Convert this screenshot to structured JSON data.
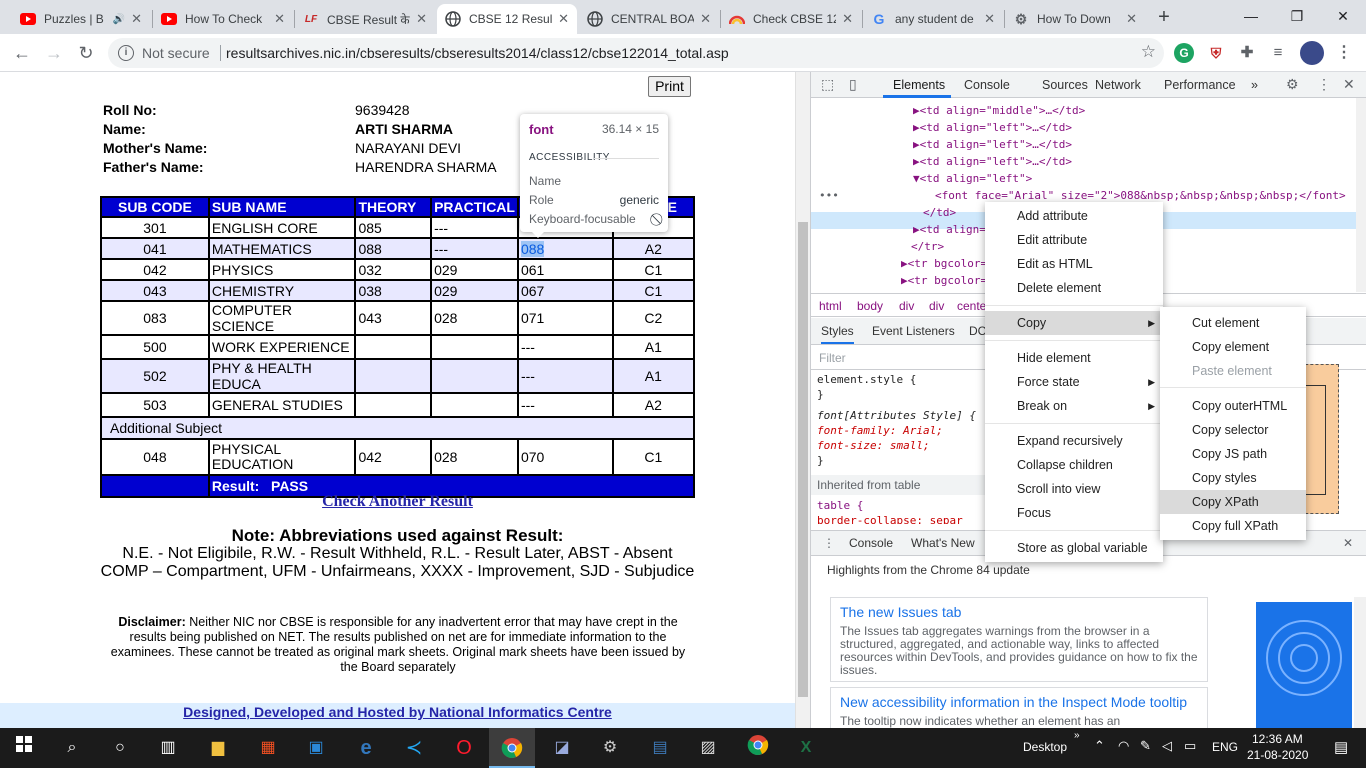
{
  "tabs": [
    {
      "title": "Puzzles | B",
      "icon": "youtube-icon"
    },
    {
      "title": "How To Check",
      "icon": "youtube-icon"
    },
    {
      "title": "CBSE Result के",
      "icon": "lf-icon"
    },
    {
      "title": "CBSE 12 Result",
      "icon": "globe-icon",
      "active": true
    },
    {
      "title": "CENTRAL BOA",
      "icon": "globe-icon"
    },
    {
      "title": "Check CBSE 12",
      "icon": "rainbow-icon"
    },
    {
      "title": "any student de",
      "icon": "google-icon"
    },
    {
      "title": "How To Down",
      "icon": "gear-icon"
    }
  ],
  "address": {
    "security": "Not secure",
    "url": "resultsarchives.nic.in/cbseresults/cbseresults2014/class12/cbse122014_total.asp"
  },
  "page": {
    "print_label": "Print",
    "info": [
      {
        "label": "Roll No:",
        "value": "9639428",
        "bold": false
      },
      {
        "label": "Name:",
        "value": "ARTI SHARMA",
        "bold": true
      },
      {
        "label": "Mother's Name:",
        "value": "NARAYANI DEVI",
        "bold": false
      },
      {
        "label": "Father's Name:",
        "value": "HARENDRA SHARMA",
        "bold": false
      }
    ],
    "table_headers": [
      "SUB CODE",
      "SUB NAME",
      "THEORY",
      "PRACTICAL",
      "",
      "E"
    ],
    "rows": [
      [
        "301",
        "ENGLISH CORE",
        "085",
        "---",
        "",
        ""
      ],
      [
        "041",
        "MATHEMATICS",
        "088",
        "---",
        "088",
        "A2"
      ],
      [
        "042",
        "PHYSICS",
        "032",
        "029",
        "061",
        "C1"
      ],
      [
        "043",
        "CHEMISTRY",
        "038",
        "029",
        "067",
        "C1"
      ],
      [
        "083",
        "COMPUTER SCIENCE",
        "043",
        "028",
        "071",
        "C2"
      ],
      [
        "500",
        "WORK EXPERIENCE",
        "",
        "",
        "---",
        "A1"
      ],
      [
        "502",
        "PHY & HEALTH EDUCA",
        "",
        "",
        "---",
        "A1"
      ],
      [
        "503",
        "GENERAL STUDIES",
        "",
        "",
        "---",
        "A2"
      ]
    ],
    "additional_label": "Additional Subject",
    "additional_row": [
      "048",
      "PHYSICAL EDUCATION",
      "042",
      "028",
      "070",
      "C1"
    ],
    "result_label": "Result:",
    "result_value": "PASS",
    "check_another": "Check Another Result",
    "note_title": "Note: Abbreviations used against Result:",
    "note_line1": "N.E. - Not Eligibile, R.W. - Result Withheld, R.L. - Result Later, ABST - Absent",
    "note_line2": "COMP – Compartment, UFM - Unfairmeans, XXXX - Improvement, SJD - Subjudice",
    "disclaimer_label": "Disclaimer:",
    "disclaimer_text": "Neither NIC nor CBSE is responsible for any inadvertent error that may have crept in the results being published on NET. The results published on net are for immediate information to the examinees. These cannot be treated as original mark sheets. Original mark sheets have been issued by the Board separately",
    "footer": "Designed, Developed and Hosted by National Informatics Centre"
  },
  "tooltip": {
    "tag": "font",
    "dims": "36.14 × 15",
    "section": "ACCESSIBILITY",
    "name_label": "Name",
    "name_value": "",
    "role_label": "Role",
    "role_value": "generic",
    "kbd_label": "Keyboard-focusable"
  },
  "devtools": {
    "tabs": [
      "Elements",
      "Console",
      "Sources",
      "Network",
      "Performance"
    ],
    "more": "»",
    "dom_lines": [
      {
        "text": "▶<td align=\"middle\">…</td>"
      },
      {
        "text": "▶<td align=\"left\">…</td>"
      },
      {
        "text": "▶<td align=\"left\">…</td>"
      },
      {
        "text": "▶<td align=\"left\">…</td>"
      },
      {
        "text": "▼<td align=\"left\">"
      },
      {
        "text": "<font face=\"Arial\" size=\"2\">088&nbsp;&nbsp;&nbsp;&nbsp;</font>"
      },
      {
        "text": "</td>"
      },
      {
        "text": "▶<td align="
      },
      {
        "text": "</tr>"
      },
      {
        "text": "▶<tr bgcolor="
      },
      {
        "text": "▶<tr bgcolor="
      }
    ],
    "breadcrumbs": [
      "html",
      "body",
      "div",
      "div",
      "cente"
    ],
    "subtabs": [
      "Styles",
      "Event Listeners",
      "DC"
    ],
    "filter_placeholder": "Filter",
    "style_lines": [
      "element.style {",
      "}",
      "font[Attributes Style] {",
      "  font-family: Arial;",
      "  font-size: small;",
      "}",
      "Inherited from table",
      "table {",
      "  border-collapse: separ"
    ],
    "drawer_tabs": [
      "Console",
      "What's New"
    ],
    "whatsnew_title": "Highlights from the Chrome 84 update",
    "cards": [
      {
        "title": "The new Issues tab",
        "desc": "The Issues tab aggregates warnings from the browser in a structured, aggregated, and actionable way, links to affected resources within DevTools, and provides guidance on how to fix the issues."
      },
      {
        "title": "New accessibility information in the Inspect Mode tooltip",
        "desc": "The tooltip now indicates whether an element has an"
      }
    ]
  },
  "context_menu": {
    "items": [
      "Add attribute",
      "Edit attribute",
      "Edit as HTML",
      "Delete element",
      "Copy",
      "Hide element",
      "Force state",
      "Break on",
      "Expand recursively",
      "Collapse children",
      "Scroll into view",
      "Focus",
      "Store as global variable"
    ]
  },
  "submenu": {
    "items": [
      "Cut element",
      "Copy element",
      "Paste element",
      "Copy outerHTML",
      "Copy selector",
      "Copy JS path",
      "Copy styles",
      "Copy XPath",
      "Copy full XPath"
    ]
  },
  "taskbar": {
    "desktop_label": "Desktop",
    "lang": "ENG",
    "time": "12:36 AM",
    "date": "21-08-2020"
  },
  "colors": {
    "table_header": "#0000d0",
    "link": "#2525a8",
    "accent": "#1a73e8"
  }
}
